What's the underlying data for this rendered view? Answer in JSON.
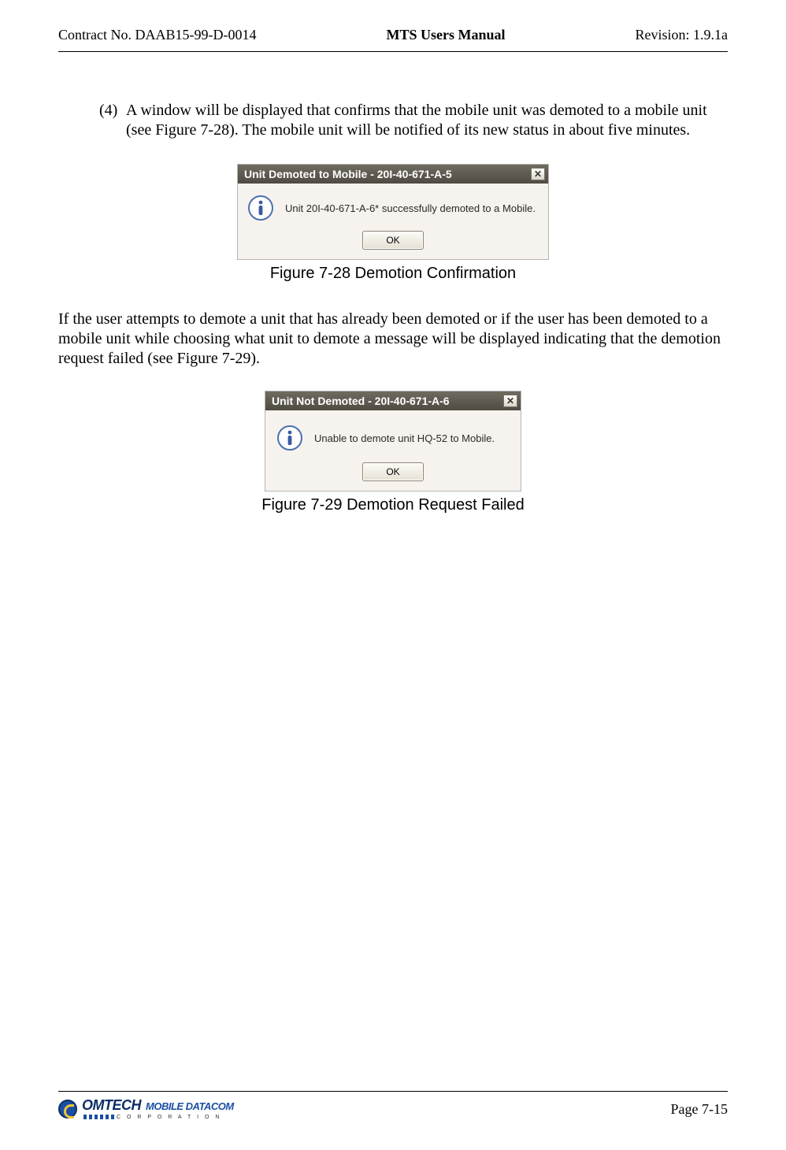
{
  "header": {
    "left": "Contract No. DAAB15-99-D-0014",
    "center": "MTS Users Manual",
    "right": "Revision:  1.9.1a"
  },
  "step4": {
    "marker": "(4)",
    "text": "A window will be displayed that confirms that the mobile unit was demoted to a mobile unit (see Figure 7-28).  The mobile unit will be notified of its new status in about five minutes."
  },
  "dialogA": {
    "title": "Unit Demoted to Mobile - 20I-40-671-A-5",
    "message": "Unit 20I-40-671-A-6* successfully demoted to a Mobile.",
    "ok": "OK"
  },
  "captionA": "Figure 7-28   Demotion Confirmation",
  "midPara": "If the user attempts to demote a unit that has already been demoted or if the user has been demoted to a mobile unit while choosing what unit to demote a message will be displayed indicating that the demotion request failed (see Figure 7-29).",
  "dialogB": {
    "title": "Unit Not Demoted - 20I-40-671-A-6",
    "message": "Unable to demote unit HQ-52 to Mobile.",
    "ok": "OK"
  },
  "captionB": "Figure 7-29   Demotion Request Failed",
  "footer": {
    "logo_main": "OMTECH",
    "logo_sub": "MOBILE DATACOM",
    "logo_corp": "C O R P O R A T I O N",
    "page": "Page 7-15"
  }
}
